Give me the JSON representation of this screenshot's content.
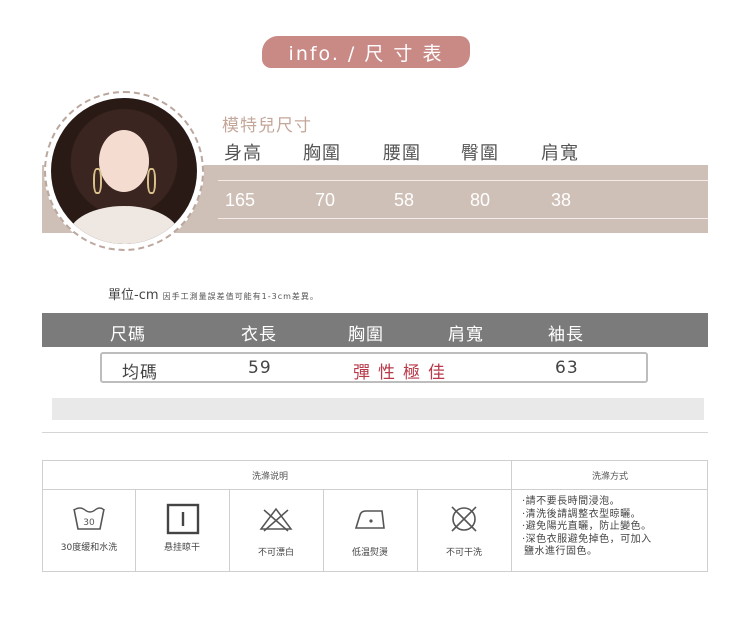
{
  "header": {
    "title": "info. / 尺 寸 表"
  },
  "model": {
    "title": "模特兒尺寸",
    "headers": [
      "身高",
      "胸圍",
      "腰圍",
      "臀圍",
      "肩寬"
    ],
    "values": [
      "165",
      "70",
      "58",
      "80",
      "38"
    ]
  },
  "unit_note": {
    "main": "單位-cm",
    "detail": "因手工測量誤差值可能有1-3cm差異。"
  },
  "size_table": {
    "headers": [
      "尺碼",
      "衣長",
      "胸圍",
      "肩寬",
      "袖長"
    ],
    "row": {
      "size": "均碼",
      "length": "59",
      "chest_note": "彈性極佳",
      "sleeve": "63"
    }
  },
  "care": {
    "header_left": "洗滌说明",
    "header_right": "洗滌方式",
    "items": [
      {
        "icon": "wash-30-icon",
        "label": "30度缓和水洗"
      },
      {
        "icon": "hang-dry-icon",
        "label": "悬挂晾干"
      },
      {
        "icon": "no-bleach-icon",
        "label": "不可漂白"
      },
      {
        "icon": "low-iron-icon",
        "label": "低温熨燙"
      },
      {
        "icon": "no-dry-clean-icon",
        "label": "不可干洗"
      }
    ],
    "wash_temp": "30",
    "notes": [
      "·請不要長時間浸泡。",
      "·清洗後請調整衣型晾曬。",
      "·避免陽光直曬，防止變色。",
      "·深色衣服避免掉色，可加入",
      " 鹽水進行固色。"
    ]
  },
  "colors": {
    "band": "#cfc0b7",
    "header_grey": "#7b7b7b",
    "title_pink": "#c98a86",
    "accent_red": "#b83a4a"
  }
}
